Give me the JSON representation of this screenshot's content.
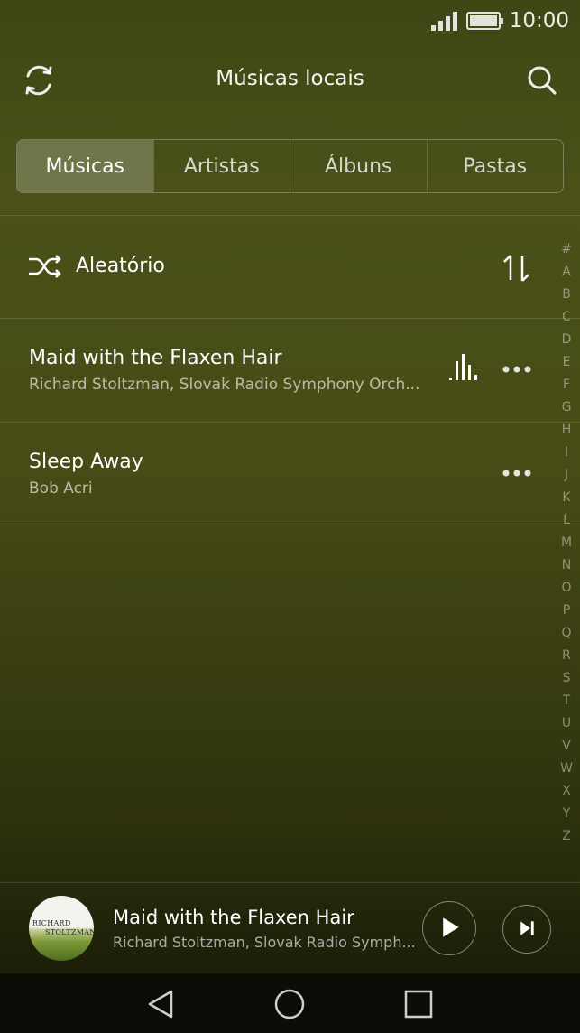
{
  "status": {
    "time": "10:00"
  },
  "header": {
    "title": "Músicas locais"
  },
  "tabs": [
    {
      "label": "Músicas",
      "active": true
    },
    {
      "label": "Artistas",
      "active": false
    },
    {
      "label": "Álbuns",
      "active": false
    },
    {
      "label": "Pastas",
      "active": false
    }
  ],
  "shuffle": {
    "label": "Aleatório"
  },
  "songs": [
    {
      "title": "Maid with the Flaxen Hair",
      "artist": "Richard Stoltzman, Slovak Radio Symphony Orch...",
      "playing": true
    },
    {
      "title": "Sleep Away",
      "artist": "Bob Acri",
      "playing": false
    }
  ],
  "alpha_index": [
    "#",
    "A",
    "B",
    "C",
    "D",
    "E",
    "F",
    "G",
    "H",
    "I",
    "J",
    "K",
    "L",
    "M",
    "N",
    "O",
    "P",
    "Q",
    "R",
    "S",
    "T",
    "U",
    "V",
    "W",
    "X",
    "Y",
    "Z"
  ],
  "now_playing": {
    "title": "Maid with the Flaxen Hair",
    "artist": "Richard Stoltzman, Slovak Radio Symph...",
    "album_art_text": [
      "RICHARD",
      "STOLTZMAN"
    ]
  },
  "icons": {
    "refresh": "refresh-icon",
    "search": "search-icon",
    "shuffle": "shuffle-icon",
    "sort": "sort-icon",
    "more": "more-icon",
    "equalizer": "equalizer-icon",
    "play": "play-icon",
    "next": "next-icon"
  }
}
